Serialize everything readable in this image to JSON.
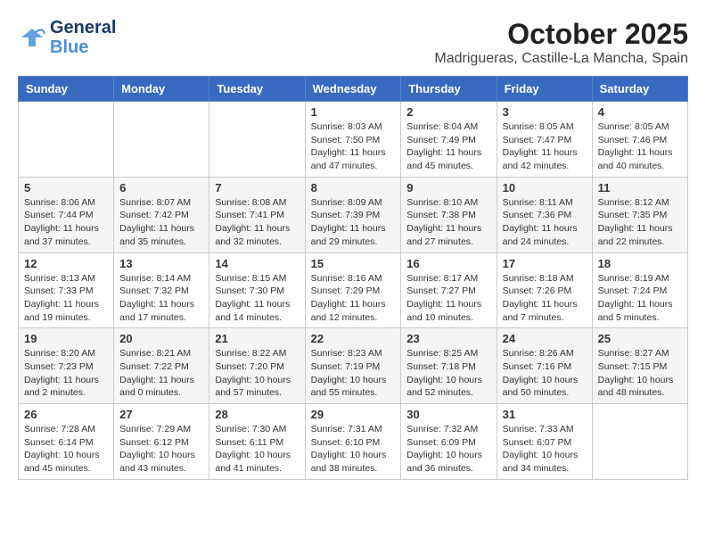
{
  "header": {
    "logo_general": "General",
    "logo_blue": "Blue",
    "month": "October 2025",
    "location": "Madrigueras, Castille-La Mancha, Spain"
  },
  "days_of_week": [
    "Sunday",
    "Monday",
    "Tuesday",
    "Wednesday",
    "Thursday",
    "Friday",
    "Saturday"
  ],
  "weeks": [
    [
      {
        "day": "",
        "content": ""
      },
      {
        "day": "",
        "content": ""
      },
      {
        "day": "",
        "content": ""
      },
      {
        "day": "1",
        "content": "Sunrise: 8:03 AM\nSunset: 7:50 PM\nDaylight: 11 hours and 47 minutes."
      },
      {
        "day": "2",
        "content": "Sunrise: 8:04 AM\nSunset: 7:49 PM\nDaylight: 11 hours and 45 minutes."
      },
      {
        "day": "3",
        "content": "Sunrise: 8:05 AM\nSunset: 7:47 PM\nDaylight: 11 hours and 42 minutes."
      },
      {
        "day": "4",
        "content": "Sunrise: 8:05 AM\nSunset: 7:46 PM\nDaylight: 11 hours and 40 minutes."
      }
    ],
    [
      {
        "day": "5",
        "content": "Sunrise: 8:06 AM\nSunset: 7:44 PM\nDaylight: 11 hours and 37 minutes."
      },
      {
        "day": "6",
        "content": "Sunrise: 8:07 AM\nSunset: 7:42 PM\nDaylight: 11 hours and 35 minutes."
      },
      {
        "day": "7",
        "content": "Sunrise: 8:08 AM\nSunset: 7:41 PM\nDaylight: 11 hours and 32 minutes."
      },
      {
        "day": "8",
        "content": "Sunrise: 8:09 AM\nSunset: 7:39 PM\nDaylight: 11 hours and 29 minutes."
      },
      {
        "day": "9",
        "content": "Sunrise: 8:10 AM\nSunset: 7:38 PM\nDaylight: 11 hours and 27 minutes."
      },
      {
        "day": "10",
        "content": "Sunrise: 8:11 AM\nSunset: 7:36 PM\nDaylight: 11 hours and 24 minutes."
      },
      {
        "day": "11",
        "content": "Sunrise: 8:12 AM\nSunset: 7:35 PM\nDaylight: 11 hours and 22 minutes."
      }
    ],
    [
      {
        "day": "12",
        "content": "Sunrise: 8:13 AM\nSunset: 7:33 PM\nDaylight: 11 hours and 19 minutes."
      },
      {
        "day": "13",
        "content": "Sunrise: 8:14 AM\nSunset: 7:32 PM\nDaylight: 11 hours and 17 minutes."
      },
      {
        "day": "14",
        "content": "Sunrise: 8:15 AM\nSunset: 7:30 PM\nDaylight: 11 hours and 14 minutes."
      },
      {
        "day": "15",
        "content": "Sunrise: 8:16 AM\nSunset: 7:29 PM\nDaylight: 11 hours and 12 minutes."
      },
      {
        "day": "16",
        "content": "Sunrise: 8:17 AM\nSunset: 7:27 PM\nDaylight: 11 hours and 10 minutes."
      },
      {
        "day": "17",
        "content": "Sunrise: 8:18 AM\nSunset: 7:26 PM\nDaylight: 11 hours and 7 minutes."
      },
      {
        "day": "18",
        "content": "Sunrise: 8:19 AM\nSunset: 7:24 PM\nDaylight: 11 hours and 5 minutes."
      }
    ],
    [
      {
        "day": "19",
        "content": "Sunrise: 8:20 AM\nSunset: 7:23 PM\nDaylight: 11 hours and 2 minutes."
      },
      {
        "day": "20",
        "content": "Sunrise: 8:21 AM\nSunset: 7:22 PM\nDaylight: 11 hours and 0 minutes."
      },
      {
        "day": "21",
        "content": "Sunrise: 8:22 AM\nSunset: 7:20 PM\nDaylight: 10 hours and 57 minutes."
      },
      {
        "day": "22",
        "content": "Sunrise: 8:23 AM\nSunset: 7:19 PM\nDaylight: 10 hours and 55 minutes."
      },
      {
        "day": "23",
        "content": "Sunrise: 8:25 AM\nSunset: 7:18 PM\nDaylight: 10 hours and 52 minutes."
      },
      {
        "day": "24",
        "content": "Sunrise: 8:26 AM\nSunset: 7:16 PM\nDaylight: 10 hours and 50 minutes."
      },
      {
        "day": "25",
        "content": "Sunrise: 8:27 AM\nSunset: 7:15 PM\nDaylight: 10 hours and 48 minutes."
      }
    ],
    [
      {
        "day": "26",
        "content": "Sunrise: 7:28 AM\nSunset: 6:14 PM\nDaylight: 10 hours and 45 minutes."
      },
      {
        "day": "27",
        "content": "Sunrise: 7:29 AM\nSunset: 6:12 PM\nDaylight: 10 hours and 43 minutes."
      },
      {
        "day": "28",
        "content": "Sunrise: 7:30 AM\nSunset: 6:11 PM\nDaylight: 10 hours and 41 minutes."
      },
      {
        "day": "29",
        "content": "Sunrise: 7:31 AM\nSunset: 6:10 PM\nDaylight: 10 hours and 38 minutes."
      },
      {
        "day": "30",
        "content": "Sunrise: 7:32 AM\nSunset: 6:09 PM\nDaylight: 10 hours and 36 minutes."
      },
      {
        "day": "31",
        "content": "Sunrise: 7:33 AM\nSunset: 6:07 PM\nDaylight: 10 hours and 34 minutes."
      },
      {
        "day": "",
        "content": ""
      }
    ]
  ]
}
